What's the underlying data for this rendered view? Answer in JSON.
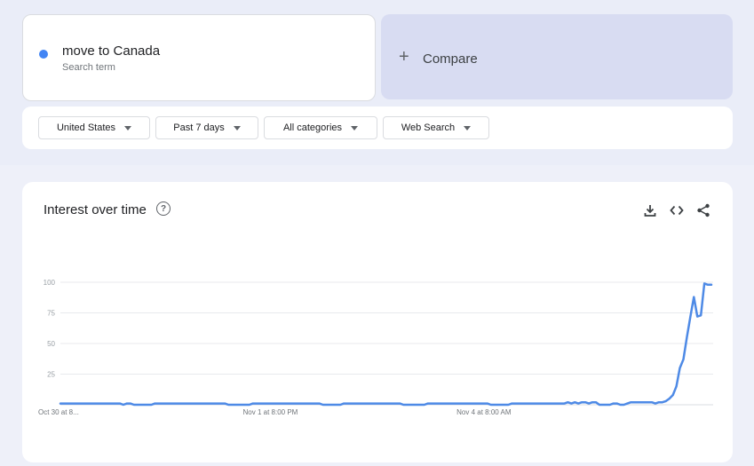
{
  "search_term": {
    "name": "move to Canada",
    "sublabel": "Search term",
    "color": "#4285f4"
  },
  "compare": {
    "label": "Compare"
  },
  "filters": {
    "region": "United States",
    "time": "Past 7 days",
    "category": "All categories",
    "property": "Web Search"
  },
  "chart_panel": {
    "title": "Interest over time",
    "icons": [
      "help-icon",
      "download-icon",
      "embed-icon",
      "share-icon"
    ]
  },
  "chart_data": {
    "type": "line",
    "title": "Interest over time",
    "xlabel": "",
    "ylabel": "",
    "ylim": [
      0,
      100
    ],
    "yticks": [
      25,
      50,
      75,
      100
    ],
    "xticks": [
      {
        "label": "Oct 30 at 8...",
        "index": 0
      },
      {
        "label": "Nov 1 at 8:00 PM",
        "index": 60
      },
      {
        "label": "Nov 4 at 8:00 AM",
        "index": 121
      }
    ],
    "grid": true,
    "line_color": "#4e8ae6",
    "series": [
      {
        "values": [
          1,
          1,
          1,
          1,
          1,
          1,
          1,
          1,
          1,
          1,
          1,
          1,
          1,
          1,
          1,
          1,
          1,
          1,
          0,
          1,
          1,
          0,
          0,
          0,
          0,
          0,
          0,
          1,
          1,
          1,
          1,
          1,
          1,
          1,
          1,
          1,
          1,
          1,
          1,
          1,
          1,
          1,
          1,
          1,
          1,
          1,
          1,
          1,
          0,
          0,
          0,
          0,
          0,
          0,
          0,
          1,
          1,
          1,
          1,
          1,
          1,
          1,
          1,
          1,
          1,
          1,
          1,
          1,
          1,
          1,
          1,
          1,
          1,
          1,
          1,
          0,
          0,
          0,
          0,
          0,
          0,
          1,
          1,
          1,
          1,
          1,
          1,
          1,
          1,
          1,
          1,
          1,
          1,
          1,
          1,
          1,
          1,
          1,
          0,
          0,
          0,
          0,
          0,
          0,
          0,
          1,
          1,
          1,
          1,
          1,
          1,
          1,
          1,
          1,
          1,
          1,
          1,
          1,
          1,
          1,
          1,
          1,
          1,
          0,
          0,
          0,
          0,
          0,
          0,
          1,
          1,
          1,
          1,
          1,
          1,
          1,
          1,
          1,
          1,
          1,
          1,
          1,
          1,
          1,
          1,
          2,
          1,
          2,
          1,
          2,
          2,
          1,
          2,
          2,
          0,
          0,
          0,
          0,
          1,
          1,
          0,
          0,
          1,
          2,
          2,
          2,
          2,
          2,
          2,
          2,
          1,
          2,
          2,
          3,
          5,
          8,
          15,
          30,
          37,
          55,
          72,
          88,
          72,
          73,
          99,
          98,
          98
        ]
      }
    ]
  }
}
